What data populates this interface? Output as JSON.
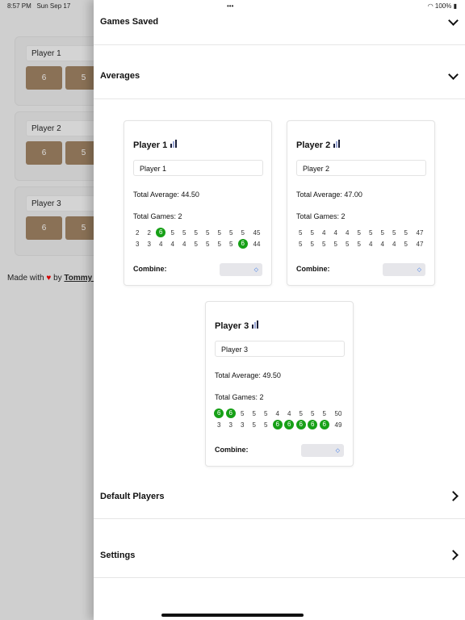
{
  "status": {
    "time": "8:57 PM",
    "date": "Sun Sep 17",
    "battery": "100%",
    "dots": "•••"
  },
  "background": {
    "players": [
      {
        "name": "Player 1",
        "buttons": [
          "6",
          "5"
        ]
      },
      {
        "name": "Player 2",
        "buttons": [
          "6",
          "5"
        ]
      },
      {
        "name": "Player 3",
        "buttons": [
          "6",
          "5"
        ]
      }
    ],
    "made_with": "Made with",
    "by": "by",
    "author": "Tommy P"
  },
  "sections": {
    "games_saved": "Games Saved",
    "averages": "Averages",
    "default_players": "Default Players",
    "settings": "Settings"
  },
  "cards": [
    {
      "title": "Player 1",
      "input": "Player 1",
      "average": "Total Average: 44.50",
      "games": "Total Games: 2",
      "rows": [
        [
          "2",
          "2",
          "6",
          "5",
          "5",
          "5",
          "5",
          "5",
          "5",
          "5",
          "45"
        ],
        [
          "3",
          "3",
          "4",
          "4",
          "4",
          "5",
          "5",
          "5",
          "5",
          "6",
          "44"
        ]
      ],
      "combine": "Combine:"
    },
    {
      "title": "Player 2",
      "input": "Player 2",
      "average": "Total Average: 47.00",
      "games": "Total Games: 2",
      "rows": [
        [
          "5",
          "5",
          "4",
          "4",
          "4",
          "5",
          "5",
          "5",
          "5",
          "5",
          "47"
        ],
        [
          "5",
          "5",
          "5",
          "5",
          "5",
          "5",
          "4",
          "4",
          "4",
          "5",
          "47"
        ]
      ],
      "combine": "Combine:"
    },
    {
      "title": "Player 3",
      "input": "Player 3",
      "average": "Total Average: 49.50",
      "games": "Total Games: 2",
      "rows": [
        [
          "6",
          "6",
          "5",
          "5",
          "5",
          "4",
          "4",
          "5",
          "5",
          "5",
          "50"
        ],
        [
          "3",
          "3",
          "3",
          "5",
          "5",
          "6",
          "6",
          "6",
          "6",
          "6",
          "49"
        ]
      ],
      "combine": "Combine:"
    }
  ],
  "colors": {
    "highlight": "#16a016",
    "button": "#8a7156",
    "heart": "#d40000"
  }
}
